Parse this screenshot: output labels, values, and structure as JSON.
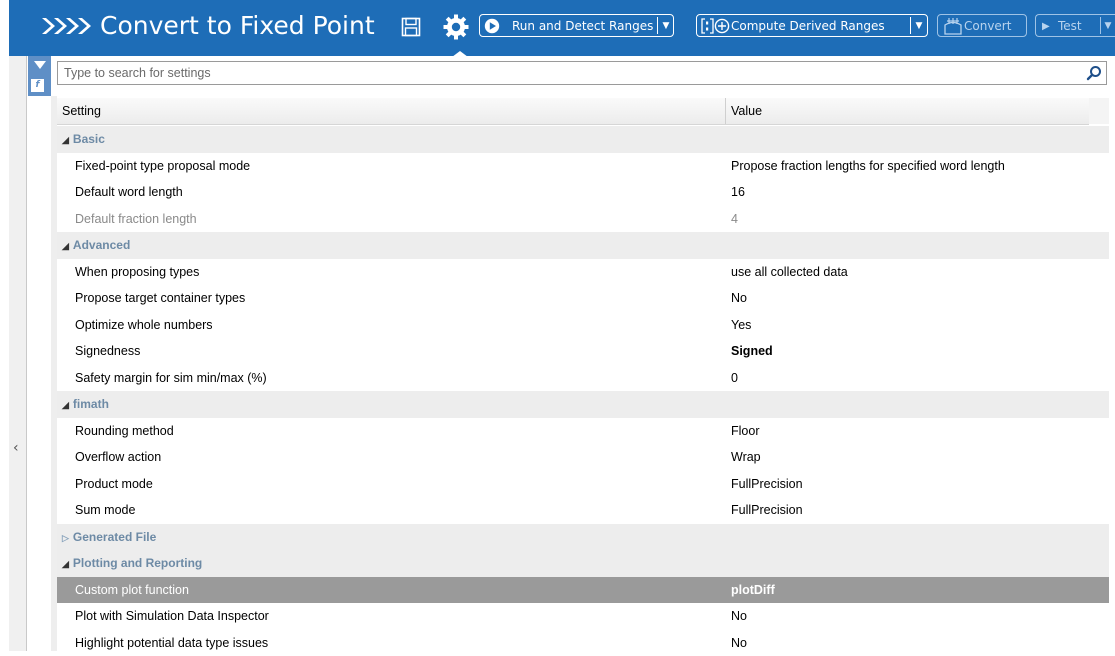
{
  "app": {
    "title": "Convert to Fixed Point"
  },
  "toolbar": {
    "run_label": "Run and Detect Ranges",
    "compute_label": "Compute Derived Ranges",
    "convert_label": "Convert",
    "test_label": "Test",
    "accent": "#1e6db7"
  },
  "search": {
    "placeholder": "Type to search for settings"
  },
  "table": {
    "headers": {
      "setting": "Setting",
      "value": "Value"
    },
    "rows": [
      {
        "type": "group",
        "label": "Basic",
        "expanded": true
      },
      {
        "label": "Fixed-point type proposal mode",
        "value": "Propose fraction lengths for specified word length"
      },
      {
        "label": "Default word length",
        "value": "16"
      },
      {
        "label": "Default fraction length",
        "value": "4",
        "disabled": true
      },
      {
        "type": "group",
        "label": "Advanced",
        "expanded": true
      },
      {
        "label": "When proposing types",
        "value": "use all collected data"
      },
      {
        "label": "Propose target container types",
        "value": "No"
      },
      {
        "label": "Optimize whole numbers",
        "value": "Yes"
      },
      {
        "label": "Signedness",
        "value": "Signed",
        "bold": true
      },
      {
        "label": "Safety margin for sim min/max (%)",
        "value": "0"
      },
      {
        "type": "group",
        "label": "fimath",
        "expanded": true
      },
      {
        "label": "Rounding method",
        "value": "Floor"
      },
      {
        "label": "Overflow action",
        "value": "Wrap"
      },
      {
        "label": "Product mode",
        "value": "FullPrecision"
      },
      {
        "label": "Sum mode",
        "value": "FullPrecision"
      },
      {
        "type": "group",
        "label": "Generated File",
        "expanded": false
      },
      {
        "type": "group",
        "label": "Plotting and Reporting",
        "expanded": true
      },
      {
        "label": "Custom plot function",
        "value": "plotDiff",
        "selected": true
      },
      {
        "label": "Plot with Simulation Data Inspector",
        "value": "No"
      },
      {
        "label": "Highlight potential data type issues",
        "value": "No"
      }
    ]
  }
}
